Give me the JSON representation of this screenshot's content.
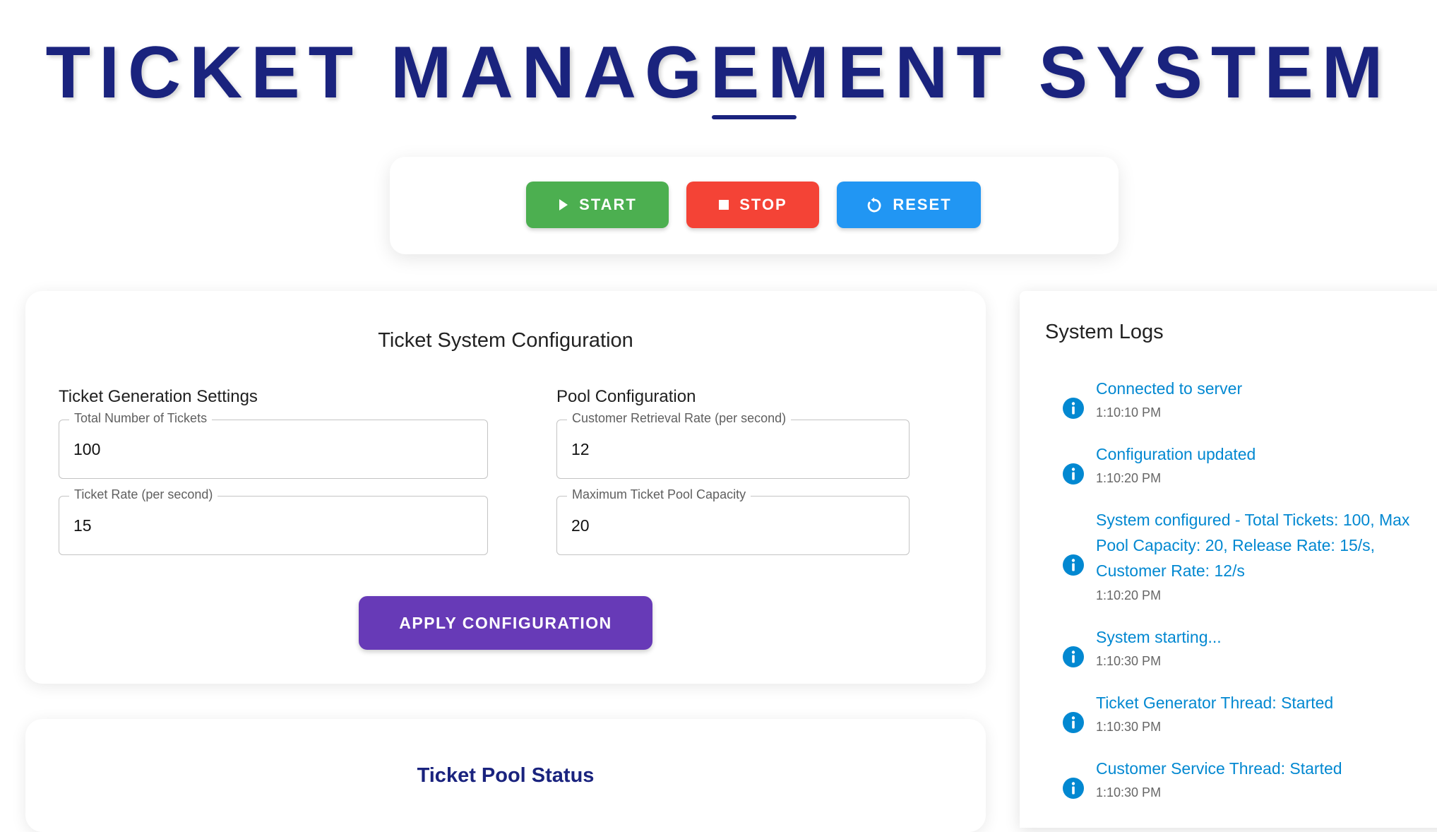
{
  "header": {
    "title": "TICKET MANAGEMENT SYSTEM"
  },
  "controls": {
    "start_label": "START",
    "stop_label": "STOP",
    "reset_label": "RESET",
    "start_icon": "play-icon",
    "stop_icon": "stop-square-icon",
    "reset_icon": "restart-icon",
    "start_color": "#4caf50",
    "stop_color": "#f44336",
    "reset_color": "#2196f3"
  },
  "config": {
    "heading": "Ticket System Configuration",
    "generation_title": "Ticket Generation Settings",
    "pool_title": "Pool Configuration",
    "fields": {
      "total_tickets": {
        "label": "Total Number of Tickets",
        "value": "100"
      },
      "ticket_rate": {
        "label": "Ticket Rate (per second)",
        "value": "15"
      },
      "retrieval_rate": {
        "label": "Customer Retrieval Rate (per second)",
        "value": "12"
      },
      "max_capacity": {
        "label": "Maximum Ticket Pool Capacity",
        "value": "20"
      }
    },
    "apply_label": "APPLY CONFIGURATION",
    "apply_color": "#673ab7"
  },
  "pool": {
    "heading": "Ticket Pool Status"
  },
  "logs": {
    "heading": "System Logs",
    "icon": "info-circle-icon",
    "text_color": "#0288d1",
    "items": [
      {
        "message": "Connected to server",
        "time": "1:10:10 PM"
      },
      {
        "message": "Configuration updated",
        "time": "1:10:20 PM"
      },
      {
        "message": "System configured - Total Tickets: 100, Max Pool Capacity: 20, Release Rate: 15/s, Customer Rate: 12/s",
        "time": "1:10:20 PM"
      },
      {
        "message": "System starting...",
        "time": "1:10:30 PM"
      },
      {
        "message": "Ticket Generator Thread: Started",
        "time": "1:10:30 PM"
      },
      {
        "message": "Customer Service Thread: Started",
        "time": "1:10:30 PM"
      }
    ]
  }
}
